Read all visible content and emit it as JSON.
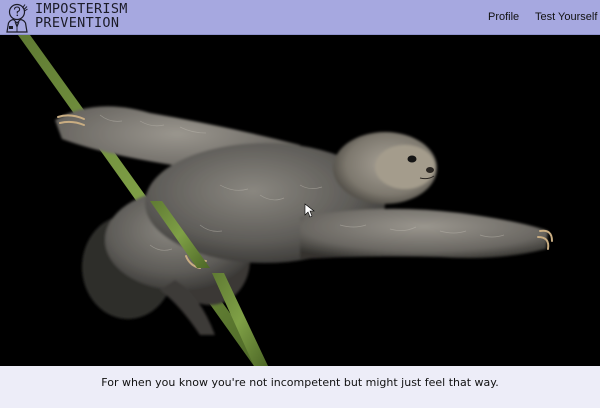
{
  "header": {
    "brand_line1": "Imposterism",
    "brand_line2": "Prevention",
    "logo_icon": "person-with-question-mark-icon",
    "nav": [
      {
        "label": "Profile"
      },
      {
        "label": "Test Yourself"
      }
    ]
  },
  "hero": {
    "image_subject": "sloth-hanging-on-branch",
    "background_color": "#000000"
  },
  "footer": {
    "tagline": "For when you know you're not incompetent but might just feel that way."
  },
  "colors": {
    "navbar_bg": "#a6a8e0",
    "footer_bg": "#ededf8",
    "text": "#111111"
  }
}
